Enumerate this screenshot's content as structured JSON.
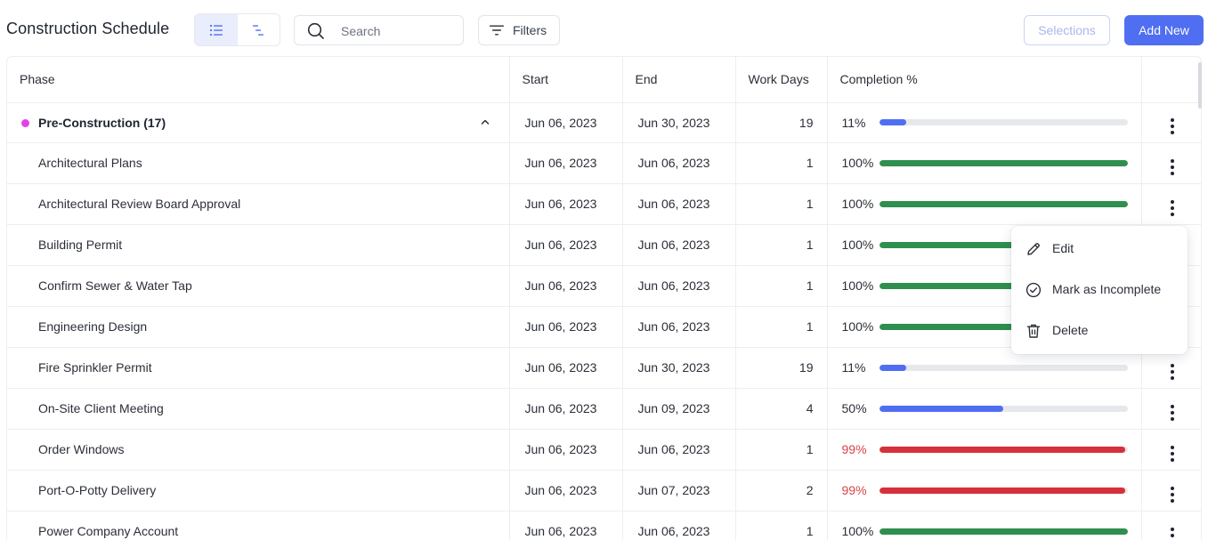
{
  "header": {
    "title": "Construction Schedule",
    "search_placeholder": "Search",
    "filters_label": "Filters",
    "selections_label": "Selections",
    "add_new_label": "Add New"
  },
  "table": {
    "columns": [
      "Phase",
      "Start",
      "End",
      "Work Days",
      "Completion %"
    ],
    "group": {
      "name": "Pre-Construction (17)",
      "start": "Jun 06, 2023",
      "end": "Jun 30, 2023",
      "work_days": "19",
      "completion_label": "11%",
      "completion": 11,
      "color": "#e341e6"
    },
    "rows": [
      {
        "phase": "Architectural Plans",
        "start": "Jun 06, 2023",
        "end": "Jun 06, 2023",
        "work_days": "1",
        "completion_label": "100%",
        "completion": 100,
        "status": "complete"
      },
      {
        "phase": "Architectural Review Board Approval",
        "start": "Jun 06, 2023",
        "end": "Jun 06, 2023",
        "work_days": "1",
        "completion_label": "100%",
        "completion": 100,
        "status": "complete"
      },
      {
        "phase": "Building Permit",
        "start": "Jun 06, 2023",
        "end": "Jun 06, 2023",
        "work_days": "1",
        "completion_label": "100%",
        "completion": 100,
        "status": "complete"
      },
      {
        "phase": "Confirm Sewer & Water Tap",
        "start": "Jun 06, 2023",
        "end": "Jun 06, 2023",
        "work_days": "1",
        "completion_label": "100%",
        "completion": 100,
        "status": "complete"
      },
      {
        "phase": "Engineering Design",
        "start": "Jun 06, 2023",
        "end": "Jun 06, 2023",
        "work_days": "1",
        "completion_label": "100%",
        "completion": 100,
        "status": "complete"
      },
      {
        "phase": "Fire Sprinkler Permit",
        "start": "Jun 06, 2023",
        "end": "Jun 30, 2023",
        "work_days": "19",
        "completion_label": "11%",
        "completion": 11,
        "status": "in-progress"
      },
      {
        "phase": "On-Site Client Meeting",
        "start": "Jun 06, 2023",
        "end": "Jun 09, 2023",
        "work_days": "4",
        "completion_label": "50%",
        "completion": 50,
        "status": "in-progress"
      },
      {
        "phase": "Order Windows",
        "start": "Jun 06, 2023",
        "end": "Jun 06, 2023",
        "work_days": "1",
        "completion_label": "99%",
        "completion": 99,
        "status": "overdue"
      },
      {
        "phase": "Port-O-Potty Delivery",
        "start": "Jun 06, 2023",
        "end": "Jun 07, 2023",
        "work_days": "2",
        "completion_label": "99%",
        "completion": 99,
        "status": "overdue"
      },
      {
        "phase": "Power Company Account",
        "start": "Jun 06, 2023",
        "end": "Jun 06, 2023",
        "work_days": "1",
        "completion_label": "100%",
        "completion": 100,
        "status": "complete"
      }
    ]
  },
  "status_colors": {
    "complete": "#2f8f4e",
    "in-progress": "#4f6ef2",
    "overdue": "#d6303a"
  },
  "context_menu": {
    "items": [
      {
        "label": "Edit",
        "icon": "pencil-icon"
      },
      {
        "label": "Mark as Incomplete",
        "icon": "check-circle-icon"
      },
      {
        "label": "Delete",
        "icon": "trash-icon"
      }
    ]
  }
}
